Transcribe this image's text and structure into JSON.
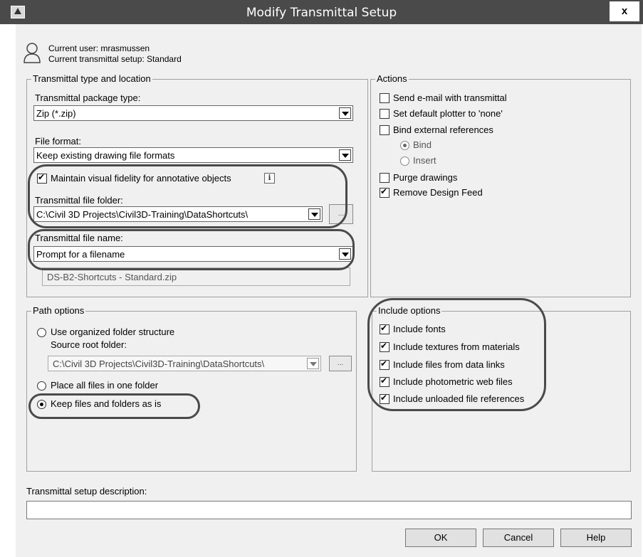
{
  "window": {
    "title": "Modify Transmittal Setup",
    "close_label": "x"
  },
  "header": {
    "current_user": "Current user: mrasmussen",
    "current_setup": "Current transmittal setup: Standard"
  },
  "type_location": {
    "group_label": "Transmittal type and location",
    "package_type_label": "Transmittal package type:",
    "package_type_value": "Zip (*.zip)",
    "file_format_label": "File format:",
    "file_format_value": "Keep existing drawing file formats",
    "fidelity_label": "Maintain visual fidelity for annotative objects",
    "fidelity_checked": true,
    "info_glyph": "i",
    "folder_label": "Transmittal file folder:",
    "folder_value": "C:\\Civil 3D Projects\\Civil3D-Training\\DataShortcuts\\",
    "folder_browse": "...",
    "filename_label": "Transmittal file name:",
    "filename_value": "Prompt for a filename",
    "filename_preview": "DS-B2-Shortcuts - Standard.zip"
  },
  "path_options": {
    "group_label": "Path options",
    "organized_label": "Use organized folder structure",
    "source_root_label": "Source root folder:",
    "source_root_value": "C:\\Civil 3D Projects\\Civil3D-Training\\DataShortcuts\\",
    "source_browse": "...",
    "one_folder_label": "Place all files in one folder",
    "keep_label": "Keep files and folders as is",
    "selected": "keep"
  },
  "actions": {
    "group_label": "Actions",
    "send_email": "Send e-mail with transmittal",
    "send_email_checked": false,
    "plotter_none": "Set default plotter to 'none'",
    "plotter_none_checked": false,
    "bind_xrefs": "Bind external references",
    "bind_xrefs_checked": false,
    "bind_option": "Bind",
    "insert_option": "Insert",
    "purge": "Purge drawings",
    "purge_checked": false,
    "remove_feed": "Remove Design Feed",
    "remove_feed_checked": true
  },
  "include_options": {
    "group_label": "Include options",
    "items": [
      {
        "label": "Include fonts",
        "checked": true
      },
      {
        "label": "Include textures from materials",
        "checked": true
      },
      {
        "label": "Include files from data links",
        "checked": true
      },
      {
        "label": "Include photometric web files",
        "checked": true
      },
      {
        "label": "Include unloaded file references",
        "checked": true
      }
    ]
  },
  "description": {
    "label": "Transmittal setup description:",
    "value": ""
  },
  "buttons": {
    "ok": "OK",
    "cancel": "Cancel",
    "help": "Help"
  },
  "colors": {
    "titlebar": "#4a4a4a",
    "dialog_bg": "#f0f0f0",
    "callout": "#4a4a4a"
  }
}
